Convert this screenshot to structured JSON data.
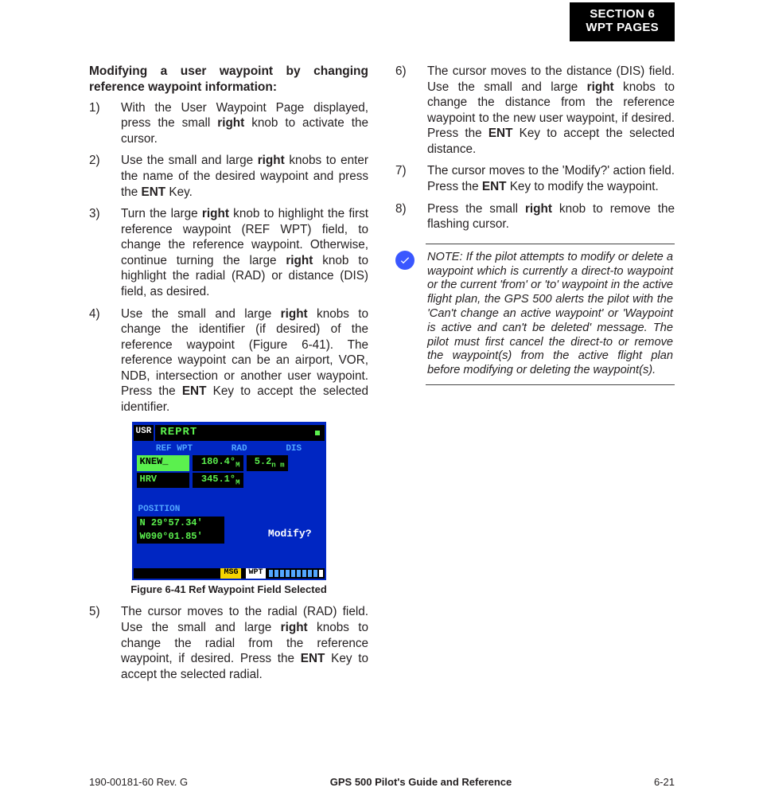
{
  "section_tab": {
    "line1": "SECTION 6",
    "line2": "WPT PAGES"
  },
  "left": {
    "heading": "Modifying a user waypoint by changing reference waypoint information:",
    "steps": [
      {
        "n": "1)",
        "pre": "With the User Waypoint Page displayed, press the small ",
        "b1": "right",
        "post": " knob to activate the cursor."
      },
      {
        "n": "2)",
        "pre": "Use the small and large ",
        "b1": "right",
        "mid": " knobs to enter the name of the desired waypoint and press the ",
        "b2": "ENT",
        "post": " Key."
      },
      {
        "n": "3)",
        "pre": "Turn the large ",
        "b1": "right",
        "mid": " knob to highlight the first reference waypoint (REF WPT) field, to change the reference waypoint.  Otherwise, continue turning the large ",
        "b2": "right",
        "post": " knob to highlight the radial (RAD) or distance (DIS) field, as desired."
      },
      {
        "n": "4)",
        "pre": "Use the small and large ",
        "b1": "right",
        "mid": " knobs to change the identifier (if desired) of the reference waypoint (Figure 6-41).  The reference waypoint can be an airport, VOR, NDB, intersection or another user waypoint.  Press the ",
        "b2": "ENT",
        "post": " Key to accept the selected identifier."
      },
      {
        "n": "5)",
        "pre": "The cursor moves to the radial (RAD) field.  Use the small and large ",
        "b1": "right",
        "mid": " knobs to change the radial from the reference waypoint, if desired.  Press the ",
        "b2": "ENT",
        "post": " Key to accept the selected radial."
      }
    ],
    "figure": {
      "caption": "Figure 6-41  Ref Waypoint Field Selected",
      "usr": "USR",
      "title": "REPRT",
      "hdr_ref": "REF WPT",
      "hdr_rad": "RAD",
      "hdr_dis": "DIS",
      "rows": [
        {
          "id": "KNEW_",
          "rad": "180.4°",
          "rad_u": "M",
          "dis": "5.2",
          "dis_u": "n m",
          "hi": true
        },
        {
          "id": "HRV",
          "rad": "345.1°",
          "rad_u": "M",
          "dis": "",
          "dis_u": "",
          "hi": false
        }
      ],
      "pos_label": "POSITION",
      "pos_lat": "N 29°57.34'",
      "pos_lon": "W090°01.85'",
      "modify": "Modify?",
      "msg": "MSG",
      "wpt": "WPT"
    }
  },
  "right": {
    "steps": [
      {
        "n": "6)",
        "pre": "The cursor moves to the distance (DIS) field.  Use the small and large ",
        "b1": "right",
        "mid": " knobs to change the distance from the reference waypoint to the new user waypoint, if desired.  Press the ",
        "b2": "ENT",
        "post": " Key to accept the selected distance."
      },
      {
        "n": "7)",
        "pre": "The cursor moves to the 'Modify?' action field.  Press the ",
        "b1": "ENT",
        "post": " Key to modify the waypoint."
      },
      {
        "n": "8)",
        "pre": "Press the small ",
        "b1": "right",
        "post": " knob to remove the flashing cursor."
      }
    ],
    "note": "NOTE:  If the pilot attempts to modify or delete a waypoint which is currently a direct-to waypoint or the current 'from' or 'to' waypoint in the active flight plan, the GPS 500 alerts the pilot with the 'Can't change an active waypoint' or 'Waypoint is active and can't be deleted' message.  The pilot must first cancel the direct-to or remove the waypoint(s) from the active flight plan before modifying or deleting the waypoint(s)."
  },
  "footer": {
    "left": "190-00181-60  Rev. G",
    "center": "GPS 500 Pilot's Guide and Reference",
    "right": "6-21"
  }
}
